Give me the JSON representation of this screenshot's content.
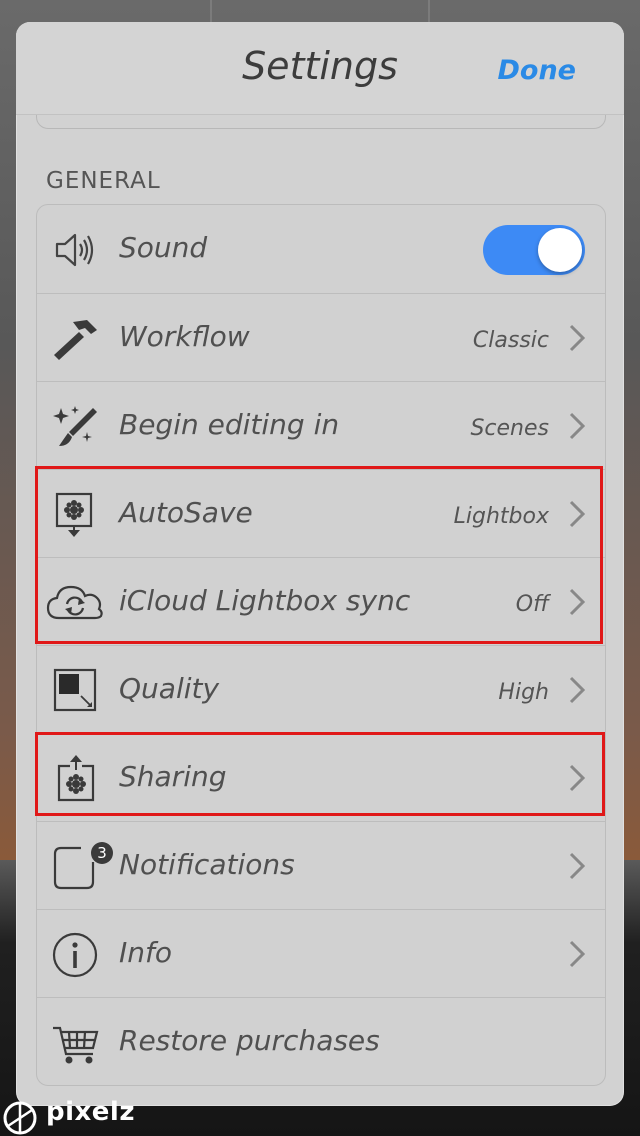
{
  "nav": {
    "title": "Settings",
    "done_label": "Done"
  },
  "section": {
    "label": "GENERAL"
  },
  "rows": [
    {
      "icon": "speaker-icon",
      "label": "Sound",
      "control": "toggle",
      "toggle_on": true
    },
    {
      "icon": "hammer-icon",
      "label": "Workflow",
      "value": "Classic"
    },
    {
      "icon": "magic-brush-icon",
      "label": "Begin editing in",
      "value": "Scenes"
    },
    {
      "icon": "autosave-icon",
      "label": "AutoSave",
      "value": "Lightbox"
    },
    {
      "icon": "icloud-sync-icon",
      "label": "iCloud Lightbox sync",
      "value": "Off"
    },
    {
      "icon": "quality-icon",
      "label": "Quality",
      "value": "High"
    },
    {
      "icon": "share-icon",
      "label": "Sharing",
      "value": ""
    },
    {
      "icon": "notification-icon",
      "label": "Notifications",
      "value": "",
      "badge": "3"
    },
    {
      "icon": "info-icon",
      "label": "Info",
      "value": ""
    },
    {
      "icon": "cart-icon",
      "label": "Restore purchases"
    }
  ],
  "colors": {
    "accent": "#2a8ae6",
    "toggle": "#3d8af5",
    "highlight": "#e01818"
  },
  "watermark": {
    "text": "pixelz"
  }
}
